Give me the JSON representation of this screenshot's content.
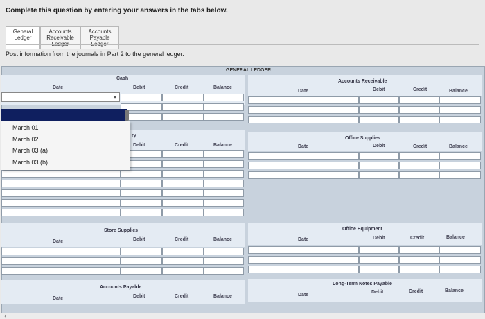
{
  "instruction": "Complete this question by entering your answers in the tabs below.",
  "tabs": [
    {
      "label": "General Ledger",
      "active": true
    },
    {
      "label": "Accounts Receivable Ledger",
      "active": false
    },
    {
      "label": "Accounts Payable Ledger",
      "active": false
    }
  ],
  "post_instruction": "Post information from the journals in Part 2 to the general ledger.",
  "ledger_title": "GENERAL LEDGER",
  "columns": {
    "date": "Date",
    "debit": "Debit",
    "credit": "Credit",
    "balance": "Balance"
  },
  "accounts": {
    "cash": "Cash",
    "second_left_partial": "ry",
    "store_supplies": "Store Supplies",
    "accounts_payable": "Accounts Payable",
    "accounts_receivable": "Accounts Receivable",
    "office_supplies": "Office Supplies",
    "office_equipment": "Office Equipment",
    "long_term_notes_payable": "Long-Term Notes Payable"
  },
  "date_dropdown": {
    "options": [
      "March 01",
      "March 02",
      "March 03 (a)",
      "March 03 (b)"
    ]
  },
  "colors": {
    "selected": "#0f1f5f",
    "header_bg": "#e4ebf3",
    "ledger_bg": "#c8d2dd"
  }
}
